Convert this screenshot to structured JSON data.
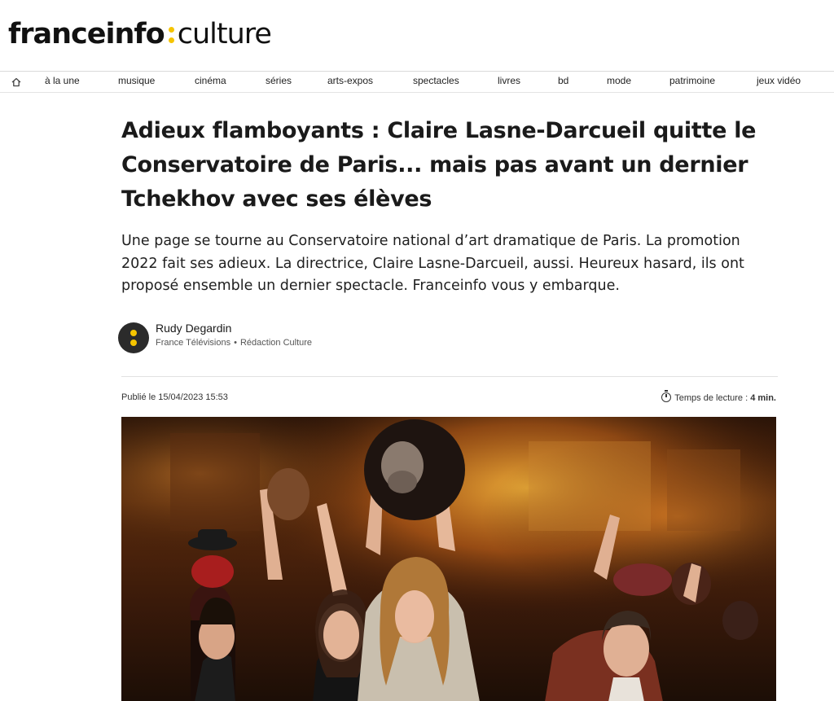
{
  "logo": {
    "brand": "franceinfo",
    "section": "culture"
  },
  "nav": {
    "home_icon": "home-icon",
    "items": [
      "à la une",
      "musique",
      "cinéma",
      "séries",
      "arts-expos",
      "spectacles",
      "livres",
      "bd",
      "mode",
      "patrimoine",
      "jeux vidéo"
    ]
  },
  "article": {
    "title": "Adieux flamboyants : Claire Lasne-Darcueil quitte le Conservatoire de Paris... mais pas avant un dernier Tchekhov avec ses élèves",
    "lede": "Une page se tourne au Conservatoire national d’art dramatique de Paris. La promotion 2022 fait ses adieux. La directrice, Claire Lasne-Darcueil, aussi. Heureux hasard, ils ont proposé ensemble un dernier spectacle. Franceinfo vous y embarque.",
    "author": {
      "name": "Rudy Degardin",
      "org": "France Télévisions",
      "team": "Rédaction Culture"
    },
    "published": "Publié le 15/04/2023 15:53",
    "read_time_label": "Temps de lecture :",
    "read_time_value": "4 min."
  },
  "colors": {
    "accent": "#f5c400",
    "text": "#1a1a1a"
  }
}
